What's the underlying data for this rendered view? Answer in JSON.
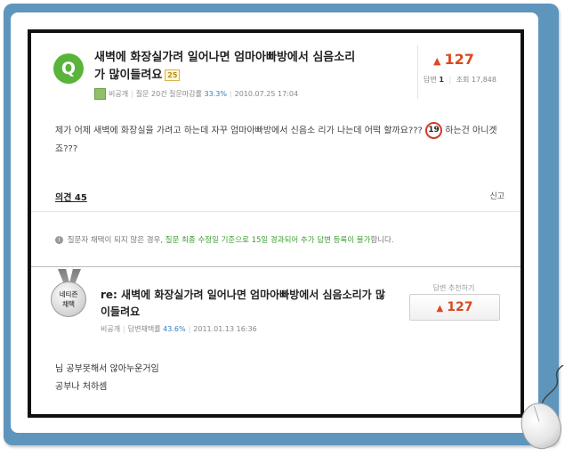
{
  "question": {
    "icon_letter": "Q",
    "title": "새벽에 화장실가려 일어나면 엄마아빠방에서 심음소리가 많이들려요",
    "badge": "25",
    "author": "비공개",
    "meta_label": "질문 20건 질문마감률",
    "meta_rate": "33.3%",
    "date": "2010.07.25 17:04",
    "vote_count": "127",
    "answers_label": "답변",
    "answers_value": "1",
    "views_label": "조회",
    "views_value": "17,848",
    "body_before": "제가 어제 새벽에 화장실을 가려고 하는데 자꾸 엄마아빠방에서 신음소 리가 나는데 어떡 할까요???",
    "body_badge": "19",
    "body_after": "하는건 아니겟죠???",
    "opinions": "의견 45",
    "report": "신고"
  },
  "notice": {
    "icon": "info-icon",
    "text_before": "질문자 채택이 되지 않은 경우,",
    "text_emphasis": "질문 최종 수정일 기준으로 15일 경과되어 추가 답변 등록이 불가",
    "text_after": "합니다."
  },
  "answer": {
    "medal_line1": "네티즌",
    "medal_line2": "채택",
    "title": "re: 새벽에 화장실가려 일어나면 엄마아빠방에서 심음소리가 많이들려요",
    "author": "비공개",
    "meta_label": "답변채택률",
    "meta_rate": "43.6%",
    "date": "2011.01.13 16:36",
    "rec_label": "답변 추천하기",
    "rec_count": "127",
    "body_line1": "님 공부못해서 않아누운거임",
    "body_line2": "공부나 처하셈"
  },
  "colors": {
    "frame": "#5e95bd",
    "accent_red": "#d94a1f",
    "green": "#5ab43c",
    "link_blue": "#2f7fc2"
  }
}
